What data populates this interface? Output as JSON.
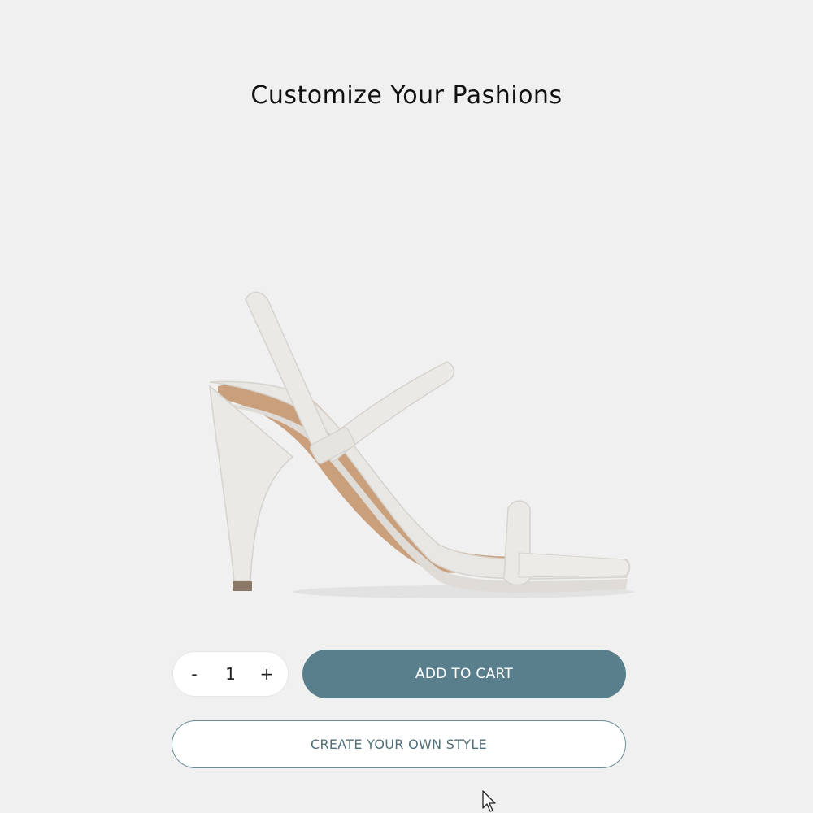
{
  "page": {
    "title": "Customize Your Pashions"
  },
  "product": {
    "image_icon": "white-strappy-heel-sandal"
  },
  "quantity": {
    "decrement_label": "-",
    "value": "1",
    "increment_label": "+"
  },
  "actions": {
    "add_to_cart_label": "ADD TO CART",
    "create_style_label": "CREATE YOUR OWN STYLE"
  },
  "colors": {
    "background": "#f0f0f0",
    "primary_button": "#5a7f8c",
    "outline_button_text": "#4f6f79"
  }
}
